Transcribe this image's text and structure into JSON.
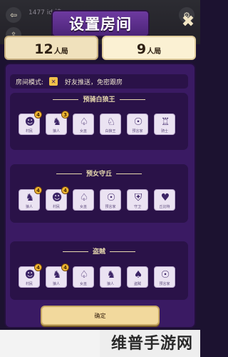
{
  "background": {
    "title": "1477 id 被",
    "left_icon": "exit-icon",
    "left_icon2": "share-icon",
    "right_icon": "gear-icon"
  },
  "banner": {
    "title": "设置房间"
  },
  "close": {
    "glyph": "✖"
  },
  "tabs": [
    {
      "num": "12",
      "unit": "人局"
    },
    {
      "num": "9",
      "unit": "人局"
    }
  ],
  "mode": {
    "label": "房间模式:",
    "value": "好友推送，免密跟房"
  },
  "sections": [
    {
      "title": "预骑白狼王",
      "roles": [
        {
          "name": "村民",
          "badge": "4",
          "icon": "villager-icon",
          "god": false
        },
        {
          "name": "狼人",
          "badge": "3",
          "icon": "wolf-icon",
          "god": false
        },
        {
          "name": "女巫",
          "badge": "",
          "icon": "witch-icon",
          "god": false
        },
        {
          "name": "白狼王",
          "badge": "",
          "icon": "white-wolf-icon",
          "god": false
        },
        {
          "name": "预言家",
          "badge": "",
          "icon": "seer-icon",
          "god": false
        },
        {
          "name": "骑士",
          "badge": "",
          "icon": "knight-icon",
          "god": false
        }
      ]
    },
    {
      "title": "预女守丘",
      "roles": [
        {
          "name": "狼人",
          "badge": "4",
          "icon": "wolf-icon",
          "god": false
        },
        {
          "name": "村民",
          "badge": "4",
          "icon": "villager-icon",
          "god": false
        },
        {
          "name": "女巫",
          "badge": "",
          "icon": "witch-icon",
          "god": false
        },
        {
          "name": "预言家",
          "badge": "",
          "icon": "seer-icon",
          "god": false
        },
        {
          "name": "守卫",
          "badge": "",
          "icon": "guard-icon",
          "god": false
        },
        {
          "name": "丘比特",
          "badge": "",
          "icon": "cupid-icon",
          "god": false
        }
      ]
    },
    {
      "title": "盗贼",
      "roles": [
        {
          "name": "村民",
          "badge": "4",
          "icon": "villager-icon",
          "god": false
        },
        {
          "name": "狼人",
          "badge": "4",
          "icon": "wolf-icon",
          "god": false
        },
        {
          "name": "女巫",
          "badge": "",
          "icon": "witch-icon",
          "god": false
        },
        {
          "name": "狼人",
          "badge": "",
          "icon": "wolf-icon",
          "god": false
        },
        {
          "name": "盗贼",
          "badge": "",
          "icon": "thief-icon",
          "god": false
        },
        {
          "name": "预言家",
          "badge": "",
          "icon": "seer-icon",
          "god": false
        }
      ]
    }
  ],
  "confirm": {
    "label": "确定"
  },
  "watermark": {
    "text": "维普手游网"
  },
  "colors": {
    "panel": "#3a1a63",
    "section": "#2a1248",
    "accent_gold": "#f2d99d",
    "badge": "#f2b933"
  }
}
